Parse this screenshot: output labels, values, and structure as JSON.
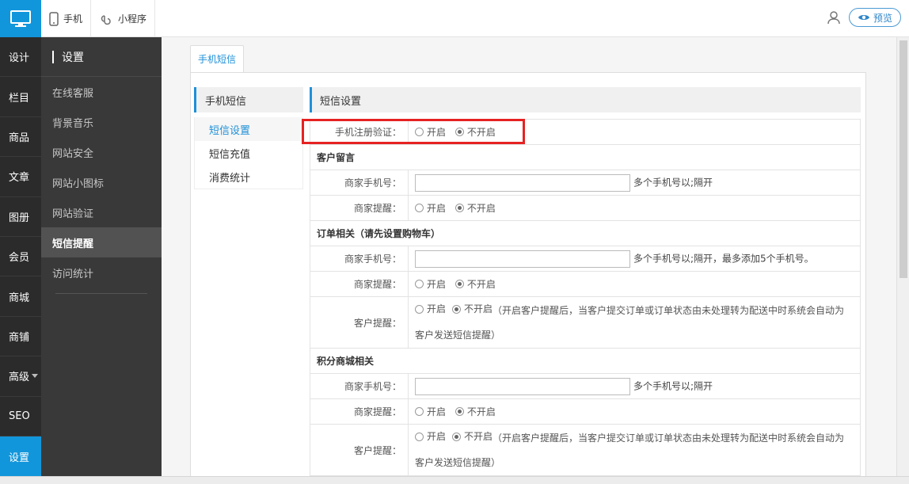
{
  "topbar": {
    "nav": [
      {
        "label": "手机",
        "icon": "phone-icon"
      },
      {
        "label": "小程序",
        "icon": "miniprogram-icon"
      }
    ],
    "preview_label": "预览"
  },
  "side1": {
    "items": [
      "设计",
      "栏目",
      "商品",
      "文章",
      "图册",
      "会员",
      "商城",
      "商铺",
      "高级",
      "SEO",
      "设置"
    ],
    "active_index": 10
  },
  "side2": {
    "title": "设置",
    "items": [
      "在线客服",
      "背景音乐",
      "网站安全",
      "网站小图标",
      "网站验证",
      "短信提醒",
      "访问统计"
    ],
    "active_index": 5
  },
  "main": {
    "tab_label": "手机短信",
    "subnav": {
      "title": "手机短信",
      "items": [
        "短信设置",
        "短信充值",
        "消费统计"
      ],
      "active_index": 0
    },
    "content_title": "短信设置",
    "radio_on": "开启",
    "radio_off": "不开启",
    "rows": {
      "register_label": "手机注册验证：",
      "guestbook_section": "客户留言",
      "merchant_phone_label": "商家手机号：",
      "merchant_notify_label": "商家提醒：",
      "customer_notify_label": "客户提醒：",
      "hint_multi": "多个手机号以;隔开",
      "hint_multi_max": "多个手机号以;隔开，最多添加5个手机号。",
      "order_section": "订单相关（请先设置购物车）",
      "points_section": "积分商城相关",
      "customer_notify_note_1": "（开启客户提醒后，当客户提交订单或订单状态由未处理转为配送中时系统会自动为",
      "customer_notify_note_2": "客户发送短信提醒）"
    }
  }
}
